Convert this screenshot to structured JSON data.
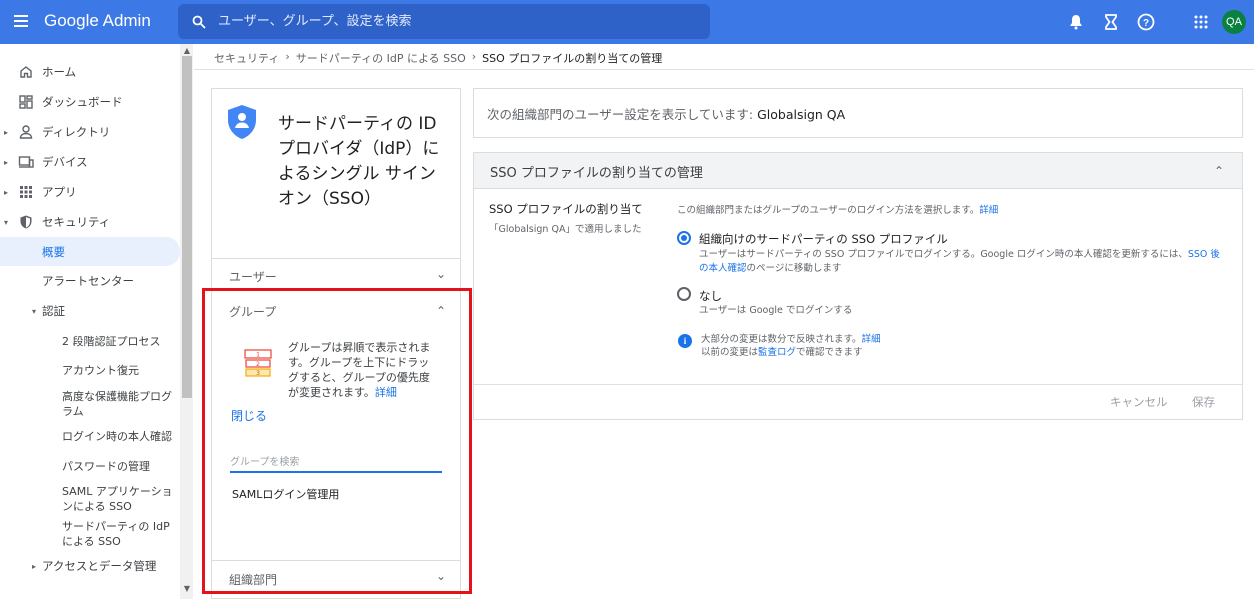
{
  "topbar": {
    "app_name": "Google Admin",
    "search_placeholder": "ユーザー、グループ、設定を検索",
    "avatar_initials": "QA",
    "brand_color": "#3c79e6"
  },
  "sidebar": {
    "items": [
      {
        "label": "ホーム",
        "icon": "home-icon"
      },
      {
        "label": "ダッシュボード",
        "icon": "dashboard-icon"
      },
      {
        "label": "ディレクトリ",
        "icon": "person-icon"
      },
      {
        "label": "デバイス",
        "icon": "devices-icon"
      },
      {
        "label": "アプリ",
        "icon": "apps-grid-icon"
      },
      {
        "label": "セキュリティ",
        "icon": "shield-icon"
      },
      {
        "label": "概要"
      },
      {
        "label": "アラートセンター"
      },
      {
        "label": "認証"
      }
    ],
    "sub_items": [
      "2 段階認証プロセス",
      "アカウント復元",
      "高度な保護機能プログラム",
      "ログイン時の本人確認",
      "パスワードの管理",
      "SAML アプリケーションによる SSO",
      "サードパーティの IdP による SSO"
    ],
    "access_label": "アクセスとデータ管理"
  },
  "breadcrumb": {
    "items": [
      "セキュリティ",
      "サードパーティの IdP による SSO"
    ],
    "current": "SSO プロファイルの割り当ての管理"
  },
  "left_card": {
    "title": "サードパーティの ID プロバイダ（IdP）によるシングル サインオン（SSO）",
    "section_users": "ユーザー",
    "section_groups": "グループ",
    "groups_desc": "グループは昇順で表示されます。グループを上下にドラッグすると、グループの優先度が変更されます。",
    "groups_desc_link": "詳細",
    "close_label": "閉じる",
    "group_search_placeholder": "グループを検索",
    "group_item": "SAMLログイン管理用",
    "section_org": "組織部門"
  },
  "info": {
    "prefix": "次の組織部門のユーザー設定を表示しています:",
    "org": "Globalsign QA"
  },
  "sso_card": {
    "title": "SSO プロファイルの割り当ての管理",
    "setting_label": "SSO プロファイルの割り当て",
    "setting_sub": "「Globalsign QA」で適用しました",
    "setting_desc": "この組織部門またはグループのユーザーのログイン方法を選択します。",
    "setting_desc_link": "詳細",
    "option1_label": "組織向けのサードパーティの SSO プロファイル",
    "option1_sub": "ユーザーはサードパーティの SSO プロファイルでログインする。Google ログイン時の本人確認を更新するには、",
    "option1_link": "SSO 後の本人確認",
    "option1_sub_tail": "のページに移動します",
    "option2_label": "なし",
    "option2_sub": "ユーザーは Google でログインする",
    "note_line1": "大部分の変更は数分で反映されます。",
    "note_link1": "詳細",
    "note_line2_pre": "以前の変更は",
    "note_link2": "監査ログ",
    "note_line2_post": "で確認できます",
    "cancel_label": "キャンセル",
    "save_label": "保存"
  }
}
